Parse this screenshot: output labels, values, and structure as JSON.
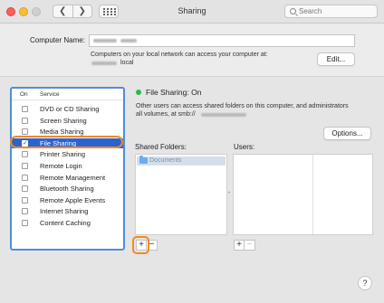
{
  "window": {
    "title": "Sharing"
  },
  "toolbar": {
    "back_glyph": "❮",
    "forward_glyph": "❯",
    "grid_icon": "grid-icon"
  },
  "search": {
    "placeholder": "Search"
  },
  "computer_name": {
    "label": "Computer Name:",
    "desc_line1": "Computers on your local network can access your computer at:",
    "desc_line2_suffix": "local",
    "edit_button": "Edit..."
  },
  "services": {
    "header_on": "On",
    "header_service": "Service",
    "items": [
      {
        "label": "DVD or CD Sharing",
        "on": false,
        "selected": false
      },
      {
        "label": "Screen Sharing",
        "on": false,
        "selected": false
      },
      {
        "label": "Media Sharing",
        "on": false,
        "selected": false
      },
      {
        "label": "File Sharing",
        "on": true,
        "selected": true
      },
      {
        "label": "Printer Sharing",
        "on": false,
        "selected": false
      },
      {
        "label": "Remote Login",
        "on": false,
        "selected": false
      },
      {
        "label": "Remote Management",
        "on": false,
        "selected": false
      },
      {
        "label": "Bluetooth Sharing",
        "on": false,
        "selected": false
      },
      {
        "label": "Remote Apple Events",
        "on": false,
        "selected": false
      },
      {
        "label": "Internet Sharing",
        "on": false,
        "selected": false
      },
      {
        "label": "Content Caching",
        "on": false,
        "selected": false
      }
    ],
    "check_glyph": "✓"
  },
  "detail": {
    "status": "File Sharing: On",
    "status_color": "#2db84a",
    "desc_line1": "Other users can access shared folders on this computer, and administrators",
    "desc_line2": "all volumes, at smb://",
    "options_button": "Options...",
    "shared_folders_label": "Shared Folders:",
    "users_label": "Users:",
    "folders": [
      {
        "name": "Documents"
      }
    ],
    "add_glyph": "+",
    "remove_glyph": "−"
  },
  "help": {
    "glyph": "?"
  },
  "colors": {
    "accent": "#2a63d0",
    "highlight": "#f08a24",
    "focus_ring": "#4e8fd6"
  }
}
